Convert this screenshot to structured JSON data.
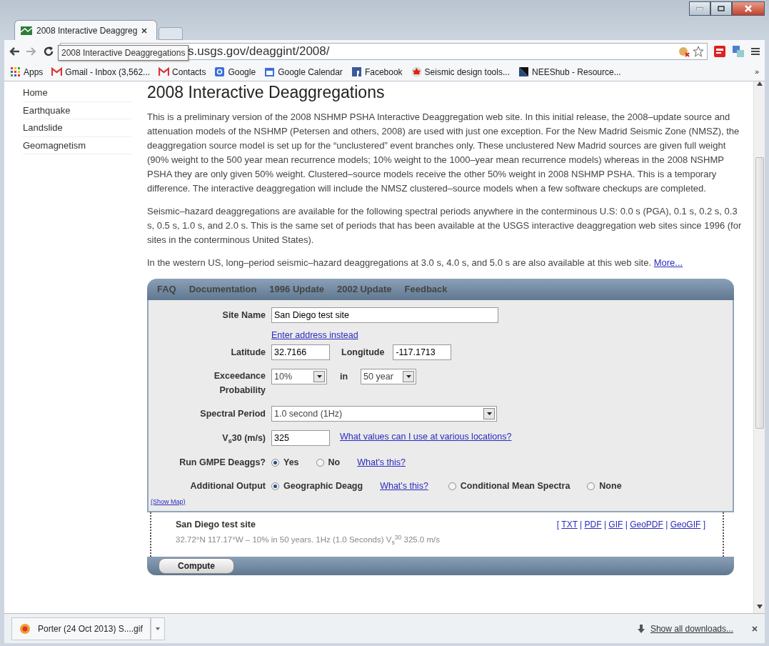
{
  "browser": {
    "tab_title": "2008 Interactive Deaggreg",
    "tooltip": "2008 Interactive Deaggregations",
    "url": "s.usgs.gov/deaggint/2008/",
    "bookmarks": [
      {
        "label": "Apps",
        "kind": "apps"
      },
      {
        "label": "Gmail - Inbox (3,562...",
        "kind": "mail"
      },
      {
        "label": "Contacts",
        "kind": "mail"
      },
      {
        "label": "Google",
        "kind": "google"
      },
      {
        "label": "Google Calendar",
        "kind": "calendar"
      },
      {
        "label": "Facebook",
        "kind": "facebook"
      },
      {
        "label": "Seismic design tools...",
        "kind": "leaf"
      },
      {
        "label": "NEEShub - Resource...",
        "kind": "neeshub"
      }
    ],
    "bookmarks_more": "»"
  },
  "sidebar": {
    "items": [
      "Home",
      "Earthquake",
      "Landslide",
      "Geomagnetism"
    ]
  },
  "page": {
    "title": "2008 Interactive Deaggregations",
    "paragraphs": [
      {
        "text": "This is a preliminary version of the 2008 NSHMP PSHA Interactive Deaggregation web site. In this initial release, the 2008–update source and attenuation models of the NSHMP (Petersen and others, 2008) are used with just one exception. For the New Madrid Seismic Zone (NMSZ), the deaggregation source model is set up for the “unclustered” event branches only. These unclustered New Madrid sources are given full weight (90% weight to the 500 year mean recurrence models; 10% weight to the 1000–year mean recurrence models) whereas in the 2008 NSHMP PSHA they are only given 50% weight. Clustered–source models receive the other 50% weight in 2008 NSHMP PSHA. This is a temporary difference. The interactive deaggregation will include the NMSZ clustered–source models when a few software checkups are completed."
      },
      {
        "text": "Seismic–hazard deaggregations are available for the following spectral periods anywhere in the conterminous U.S: 0.0 s (PGA), 0.1 s, 0.2 s, 0.3 s, 0.5 s, 1.0 s, and 2.0 s. This is the same set of periods that has been available at the USGS interactive deaggregation web sites since 1996 (for sites in the conterminous United States)."
      },
      {
        "text": "In the western US, long–period seismic–hazard deaggregations at 3.0 s, 4.0 s, and 5.0 s are also available at this web site.",
        "link": "More..."
      }
    ]
  },
  "form": {
    "nav": [
      "FAQ",
      "Documentation",
      "1996 Update",
      "2002 Update",
      "Feedback"
    ],
    "site_name": {
      "label": "Site Name",
      "value": "San Diego test site"
    },
    "address_link": "Enter address instead",
    "latitude": {
      "label": "Latitude",
      "value": "32.7166"
    },
    "longitude": {
      "label": "Longitude",
      "value": "-117.1713"
    },
    "exceedance": {
      "label": "Exceedance Probability",
      "value": "10%",
      "joiner": "in",
      "period": "50 year"
    },
    "spectral_period": {
      "label": "Spectral Period",
      "value": "1.0 second (1Hz)"
    },
    "vs30": {
      "label": "V$_{s}$30 (m/s)",
      "value": "325",
      "link": "What values can I use at various locations?"
    },
    "gmpe": {
      "label": "Run GMPE Deaggs?",
      "options": [
        {
          "label": "Yes",
          "selected": true
        },
        {
          "label": "No",
          "selected": false
        }
      ],
      "link": "What's this?"
    },
    "additional_output": {
      "label": "Additional Output",
      "options": [
        {
          "label": "Geographic Deagg",
          "selected": true,
          "link": "What's this?"
        },
        {
          "label": "Conditional Mean Spectra",
          "selected": false
        },
        {
          "label": "None",
          "selected": false
        }
      ]
    },
    "show_map": "(Show Map)"
  },
  "result": {
    "title": "San Diego test site",
    "open": "[",
    "separator": "|",
    "close": "]",
    "formats": [
      "TXT",
      "PDF",
      "GIF",
      "GeoPDF",
      "GeoGIF"
    ],
    "summary": "32.72°N 117.17°W – 10% in 50 years. 1Hz (1.0 Seconds) V$_{s}$$^{30}$ 325.0 m/s"
  },
  "compute": "Compute",
  "downloads": {
    "item": "Porter (24 Oct 2013) S....gif",
    "show_all": "Show all downloads..."
  }
}
